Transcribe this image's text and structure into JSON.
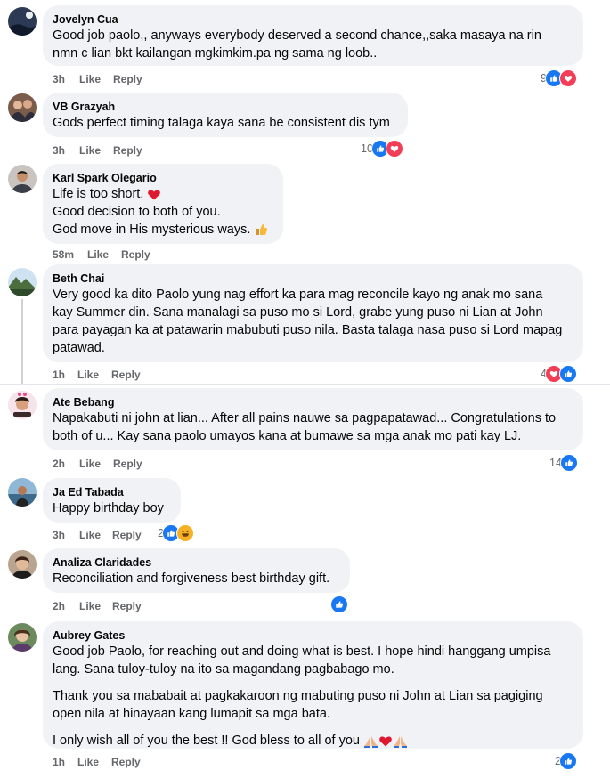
{
  "actions": {
    "like": "Like",
    "reply": "Reply"
  },
  "colors": {
    "like": "#1877f2",
    "love": "#f33e58",
    "haha": "#f7b125",
    "bubble": "#f0f2f5",
    "meta": "#65676b"
  },
  "comments": [
    {
      "author": "Jovelyn Cua",
      "lines": [
        "Good job paolo,, anyways everybody deserved a second chance,,saka masaya na rin",
        "nmn c lian bkt kailangan mgkimkim.pa ng sama ng loob.."
      ],
      "time": "3h",
      "reactions": {
        "count": "9",
        "icons": [
          "like-icon",
          "love-icon"
        ]
      }
    },
    {
      "author": "VB Grazyah",
      "lines": [
        "Gods perfect timing talaga kaya sana be consistent dis tym"
      ],
      "time": "3h",
      "reactions": {
        "count": "10",
        "icons": [
          "like-icon",
          "love-icon"
        ]
      }
    },
    {
      "author": "Karl Spark Olegario",
      "lines": [
        "Life is too short.",
        "Good decision to both of you.",
        "God move in His mysterious ways."
      ],
      "time": "58m",
      "reactions": null
    },
    {
      "author": "Beth Chai",
      "lines": [
        "Very good ka dito Paolo yung nag effort ka para mag reconcile kayo ng anak mo sana",
        "kay Summer din. Sana manalagi sa puso mo si Lord, grabe yung puso ni Lian at John",
        "para payagan ka at patawarin mabubuti puso nila. Basta talaga nasa puso si Lord mapag",
        "patawad."
      ],
      "time": "1h",
      "reactions": {
        "count": "4",
        "icons": [
          "love-icon",
          "like-icon"
        ]
      }
    },
    {
      "author": "Ate Bebang",
      "lines": [
        "Napakabuti ni john at lian... After all pains nauwe sa pagpapatawad... Congratulations to",
        "both of u... Kay sana paolo umayos kana at bumawe sa mga anak mo pati kay LJ."
      ],
      "time": "2h",
      "reactions": {
        "count": "14",
        "icons": [
          "like-icon"
        ]
      }
    },
    {
      "author": "Ja Ed Tabada",
      "lines": [
        "Happy birthday boy"
      ],
      "time": "3h",
      "reactions": {
        "count": "2",
        "icons": [
          "like-icon",
          "haha-icon"
        ]
      }
    },
    {
      "author": "Analiza Claridades",
      "lines": [
        "Reconciliation and forgiveness best birthday gift."
      ],
      "time": "2h",
      "reactions": {
        "count": "",
        "icons": [
          "like-icon"
        ]
      }
    },
    {
      "author": "Aubrey Gates",
      "lines": [
        "Good job Paolo, for reaching out and doing what is best. I hope hindi hanggang umpisa",
        "lang. Sana tuloy-tuloy na ito sa magandang pagbabago mo.",
        "Thank you sa mababait at pagkakaroon ng mabuting puso ni John at Lian sa pagiging",
        "open nila at hinayaan kang lumapit sa mga bata.",
        "I only wish all of you the best !! God bless to all of you"
      ],
      "time": "1h",
      "reactions": {
        "count": "2",
        "icons": [
          "like-icon"
        ]
      }
    }
  ]
}
